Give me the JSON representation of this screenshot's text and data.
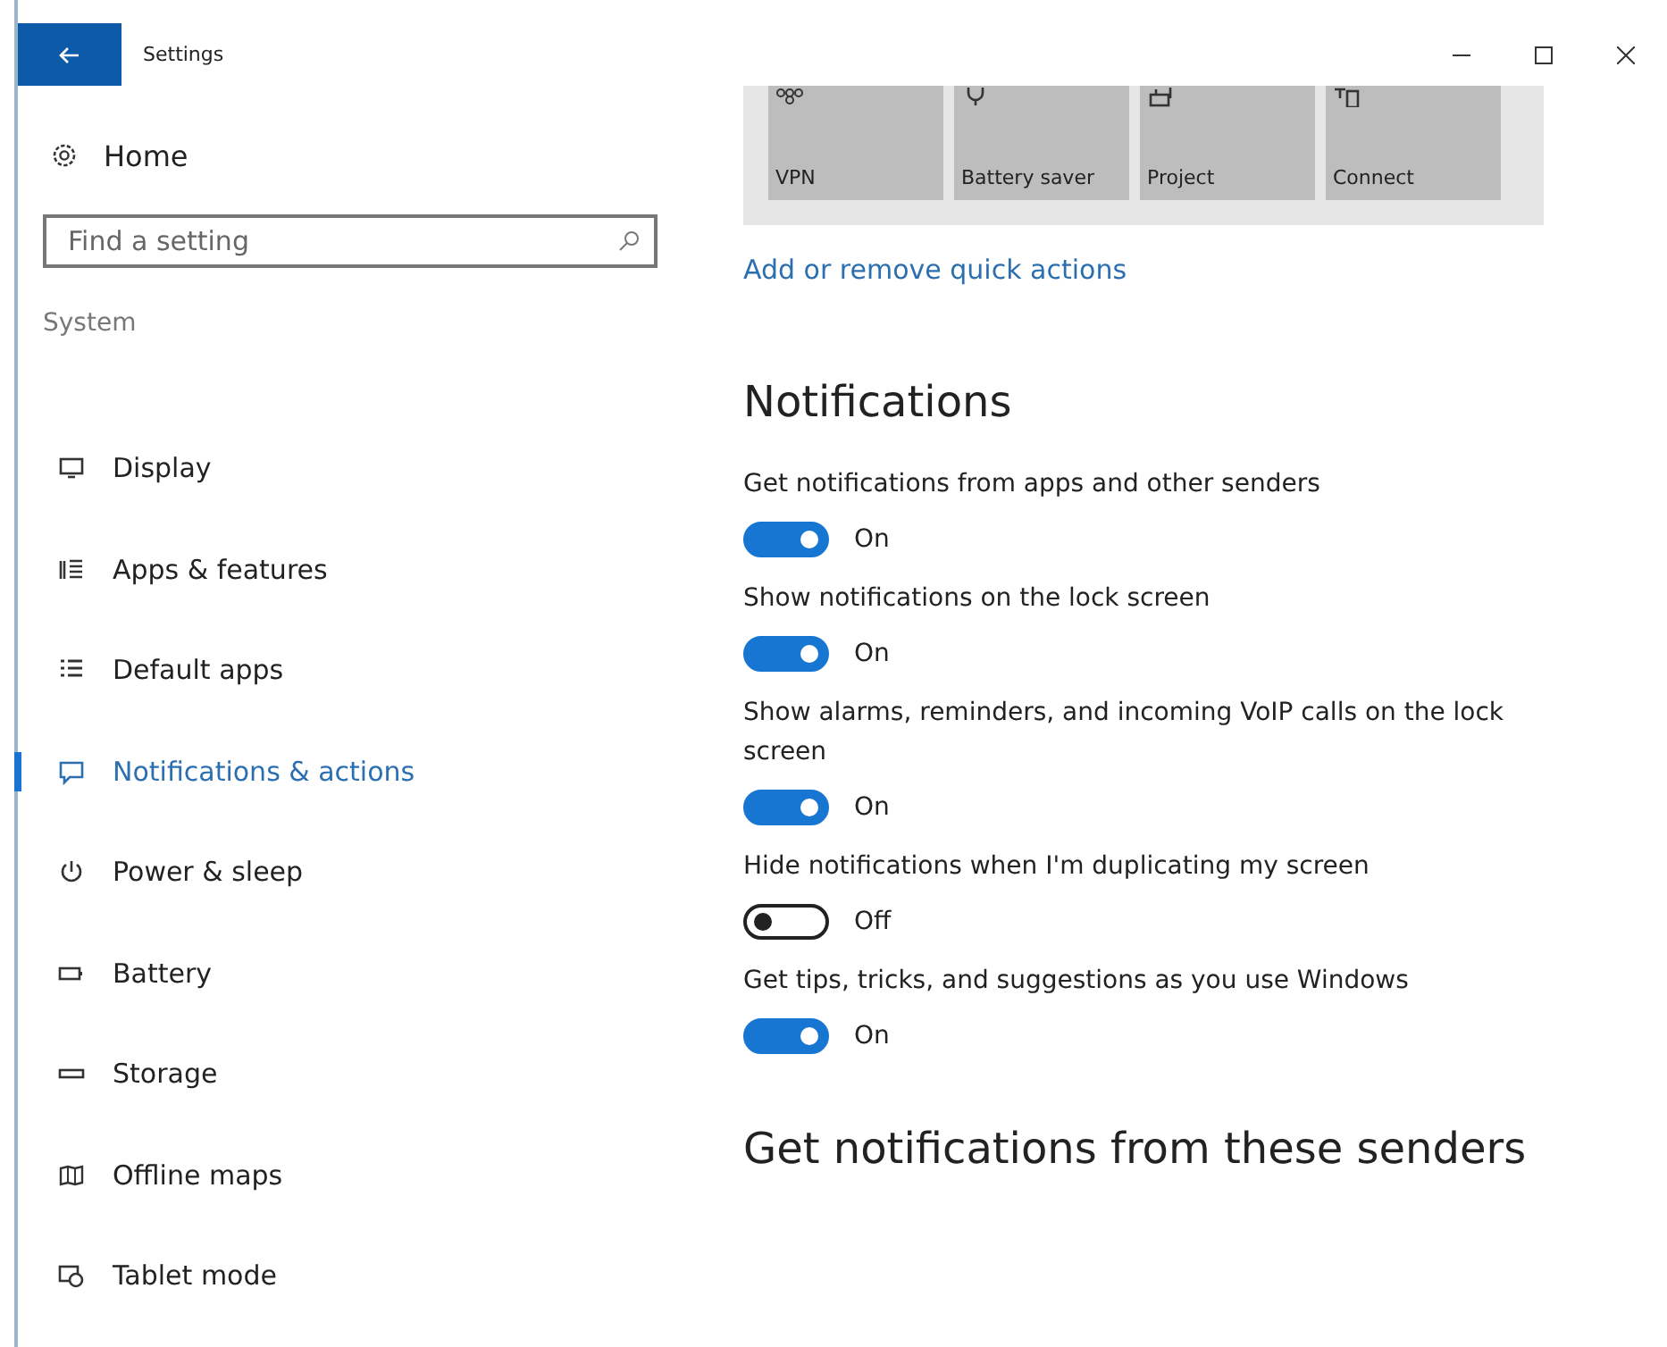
{
  "window": {
    "title": "Settings"
  },
  "sidebar": {
    "home": "Home",
    "search": {
      "placeholder": "Find a setting"
    },
    "section": "System",
    "items": [
      {
        "label": "Display",
        "selected": false
      },
      {
        "label": "Apps & features",
        "selected": false
      },
      {
        "label": "Default apps",
        "selected": false
      },
      {
        "label": "Notifications & actions",
        "selected": true
      },
      {
        "label": "Power & sleep",
        "selected": false
      },
      {
        "label": "Battery",
        "selected": false
      },
      {
        "label": "Storage",
        "selected": false
      },
      {
        "label": "Offline maps",
        "selected": false
      },
      {
        "label": "Tablet mode",
        "selected": false
      }
    ]
  },
  "quick_actions": [
    {
      "label": "VPN"
    },
    {
      "label": "Battery saver"
    },
    {
      "label": "Project"
    },
    {
      "label": "Connect"
    }
  ],
  "quick_actions_link": "Add or remove quick actions",
  "notifications": {
    "heading": "Notifications",
    "settings": [
      {
        "label": "Get notifications from apps and other senders",
        "on": true,
        "state_text": "On"
      },
      {
        "label": "Show notifications on the lock screen",
        "on": true,
        "state_text": "On"
      },
      {
        "label": "Show alarms, reminders, and incoming VoIP calls on the lock screen",
        "on": true,
        "state_text": "On"
      },
      {
        "label": "Hide notifications when I'm duplicating my screen",
        "on": false,
        "state_text": "Off"
      },
      {
        "label": "Get tips, tricks, and suggestions as you use Windows",
        "on": true,
        "state_text": "On"
      }
    ]
  },
  "senders_heading": "Get notifications from these senders"
}
